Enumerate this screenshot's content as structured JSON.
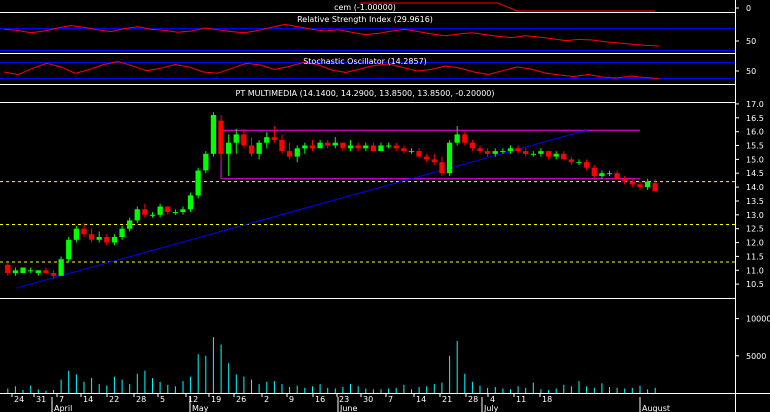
{
  "panels": {
    "cem": {
      "title": "cem (-1.00000)",
      "ticks": [
        "0"
      ]
    },
    "rsi": {
      "title": "Relative Strength Index (29.9616)",
      "ticks": [
        "50"
      ]
    },
    "stoch": {
      "title": "Stochastic Oscillator (14.2857)",
      "ticks": [
        "50"
      ]
    },
    "price": {
      "title": "PT MULTIMEDIA (14.1400, 14.2900, 13.8500, 13.8500, -0.20000)",
      "ticks": [
        "17.0",
        "16.5",
        "16.0",
        "15.5",
        "15.0",
        "14.5",
        "14.0",
        "13.5",
        "13.0",
        "12.5",
        "12.0",
        "11.5",
        "11.0",
        "10.5"
      ]
    },
    "volume": {
      "ticks": [
        "10000",
        "5000"
      ]
    }
  },
  "x_axis": {
    "day_labels": [
      "24",
      "31",
      "7",
      "14",
      "22",
      "28",
      "5",
      "12",
      "19",
      "26",
      "2",
      "9",
      "16",
      "23",
      "30",
      "7",
      "14",
      "21",
      "28",
      "4",
      "11",
      "18"
    ],
    "month_labels": [
      "April",
      "May",
      "June",
      "July",
      "August"
    ]
  },
  "colors": {
    "up_candle": "#00ff00",
    "down_candle": "#ff0000",
    "volume_bar": "#00ffff",
    "trendline": "#0000ff",
    "channel": "#ff00ff",
    "support_lines": "#ffff00",
    "indicator_line": "#ff0000",
    "band_lines": "#0000ff"
  },
  "chart_data": [
    {
      "type": "line",
      "title": "cem (-1.00000)",
      "series": [
        {
          "values": [
            0,
            0,
            0,
            0,
            0,
            0,
            0,
            0,
            -1,
            -1,
            -1,
            -1,
            -1,
            -1,
            -1,
            -1
          ]
        }
      ]
    },
    {
      "type": "line",
      "title": "Relative Strength Index (29.9616)",
      "ylim": [
        20,
        80
      ],
      "series": [
        {
          "values": [
            58,
            56,
            52,
            55,
            60,
            64,
            61,
            57,
            54,
            59,
            62,
            58,
            56,
            53,
            55,
            60,
            57,
            54,
            52,
            56,
            61,
            66,
            62,
            58,
            55,
            57,
            53,
            49,
            51,
            55,
            58,
            54,
            50,
            47,
            50,
            52,
            49,
            46,
            44,
            47,
            45,
            42,
            39,
            41,
            40,
            37,
            35,
            33,
            31,
            30
          ]
        }
      ]
    },
    {
      "type": "line",
      "title": "Stochastic Oscillator (14.2857)",
      "ylim": [
        0,
        100
      ],
      "series": [
        {
          "values": [
            40,
            30,
            55,
            75,
            60,
            35,
            50,
            70,
            82,
            65,
            45,
            55,
            70,
            60,
            40,
            35,
            55,
            75,
            68,
            50,
            62,
            78,
            70,
            48,
            38,
            52,
            66,
            72,
            58,
            44,
            50,
            64,
            56,
            40,
            30,
            45,
            60,
            52,
            36,
            28,
            22,
            30,
            20,
            16,
            24,
            18,
            14
          ]
        }
      ]
    },
    {
      "type": "candlestick",
      "title": "PT MULTIMEDIA (14.1400, 14.2900, 13.8500, 13.8500, -0.20000)",
      "ylim": [
        10.0,
        17.25
      ],
      "ohlc": [
        [
          11.2,
          11.3,
          10.8,
          10.9
        ],
        [
          10.9,
          11.1,
          10.8,
          11.0
        ],
        [
          10.9,
          11.1,
          10.9,
          11.1
        ],
        [
          11.0,
          11.1,
          10.9,
          11.0
        ],
        [
          10.9,
          11.0,
          10.8,
          11.0
        ],
        [
          11.0,
          11.1,
          10.9,
          10.9
        ],
        [
          10.9,
          11.0,
          10.7,
          10.8
        ],
        [
          10.8,
          11.5,
          10.8,
          11.4
        ],
        [
          11.4,
          12.2,
          11.3,
          12.1
        ],
        [
          12.1,
          12.6,
          12.0,
          12.5
        ],
        [
          12.5,
          12.7,
          12.2,
          12.3
        ],
        [
          12.3,
          12.5,
          12.0,
          12.1
        ],
        [
          12.1,
          12.4,
          12.0,
          12.2
        ],
        [
          12.2,
          12.3,
          11.9,
          12.0
        ],
        [
          12.0,
          12.3,
          11.9,
          12.2
        ],
        [
          12.2,
          12.6,
          12.1,
          12.5
        ],
        [
          12.5,
          12.9,
          12.4,
          12.8
        ],
        [
          12.8,
          13.3,
          12.7,
          13.2
        ],
        [
          13.2,
          13.4,
          12.9,
          13.0
        ],
        [
          13.0,
          13.1,
          12.9,
          13.0
        ],
        [
          13.0,
          13.4,
          12.9,
          13.3
        ],
        [
          13.3,
          13.3,
          13.0,
          13.1
        ],
        [
          13.1,
          13.2,
          13.0,
          13.1
        ],
        [
          13.1,
          13.3,
          13.0,
          13.2
        ],
        [
          13.2,
          13.8,
          13.1,
          13.7
        ],
        [
          13.7,
          14.7,
          13.6,
          14.6
        ],
        [
          14.6,
          15.3,
          14.5,
          15.2
        ],
        [
          15.2,
          16.7,
          15.1,
          16.6
        ],
        [
          16.4,
          16.6,
          15.0,
          15.2
        ],
        [
          15.2,
          15.9,
          14.4,
          15.6
        ],
        [
          15.6,
          16.1,
          15.2,
          15.9
        ],
        [
          15.9,
          16.1,
          15.4,
          15.5
        ],
        [
          15.5,
          15.8,
          15.1,
          15.2
        ],
        [
          15.2,
          15.7,
          15.0,
          15.6
        ],
        [
          15.6,
          16.0,
          15.4,
          15.8
        ],
        [
          15.8,
          16.2,
          15.6,
          15.7
        ],
        [
          15.7,
          15.9,
          15.2,
          15.3
        ],
        [
          15.3,
          15.6,
          15.0,
          15.1
        ],
        [
          15.1,
          15.5,
          14.9,
          15.4
        ],
        [
          15.4,
          15.6,
          15.2,
          15.5
        ],
        [
          15.5,
          15.7,
          15.3,
          15.4
        ],
        [
          15.4,
          15.7,
          15.4,
          15.6
        ],
        [
          15.6,
          15.7,
          15.4,
          15.5
        ],
        [
          15.5,
          15.8,
          15.4,
          15.6
        ],
        [
          15.6,
          15.6,
          15.3,
          15.4
        ],
        [
          15.4,
          15.7,
          15.3,
          15.5
        ],
        [
          15.5,
          15.6,
          15.3,
          15.4
        ],
        [
          15.4,
          15.6,
          15.3,
          15.5
        ],
        [
          15.5,
          15.6,
          15.3,
          15.3
        ],
        [
          15.3,
          15.6,
          15.3,
          15.5
        ],
        [
          15.5,
          15.6,
          15.4,
          15.5
        ],
        [
          15.5,
          15.6,
          15.3,
          15.4
        ],
        [
          15.4,
          15.5,
          15.2,
          15.3
        ],
        [
          15.3,
          15.4,
          15.2,
          15.3
        ],
        [
          15.3,
          15.4,
          15.1,
          15.1
        ],
        [
          15.1,
          15.2,
          14.9,
          15.0
        ],
        [
          15.0,
          15.2,
          14.8,
          14.9
        ],
        [
          14.9,
          15.1,
          14.4,
          14.5
        ],
        [
          14.5,
          15.7,
          14.4,
          15.6
        ],
        [
          15.6,
          16.2,
          15.5,
          15.9
        ],
        [
          15.9,
          16.0,
          15.5,
          15.6
        ],
        [
          15.6,
          15.7,
          15.3,
          15.4
        ],
        [
          15.4,
          15.5,
          15.2,
          15.3
        ],
        [
          15.3,
          15.4,
          15.1,
          15.2
        ],
        [
          15.2,
          15.4,
          15.1,
          15.3
        ],
        [
          15.3,
          15.4,
          15.2,
          15.3
        ],
        [
          15.3,
          15.5,
          15.2,
          15.4
        ],
        [
          15.4,
          15.5,
          15.2,
          15.3
        ],
        [
          15.3,
          15.4,
          15.1,
          15.2
        ],
        [
          15.2,
          15.3,
          15.1,
          15.2
        ],
        [
          15.2,
          15.4,
          15.1,
          15.3
        ],
        [
          15.3,
          15.3,
          15.0,
          15.1
        ],
        [
          15.1,
          15.3,
          15.0,
          15.2
        ],
        [
          15.2,
          15.3,
          15.0,
          15.0
        ],
        [
          15.0,
          15.1,
          14.8,
          14.9
        ],
        [
          14.9,
          15.0,
          14.8,
          14.9
        ],
        [
          14.9,
          15.0,
          14.6,
          14.7
        ],
        [
          14.7,
          14.8,
          14.3,
          14.4
        ],
        [
          14.4,
          14.6,
          14.3,
          14.5
        ],
        [
          14.5,
          14.6,
          14.4,
          14.5
        ],
        [
          14.5,
          14.6,
          14.3,
          14.3
        ],
        [
          14.3,
          14.4,
          14.1,
          14.2
        ],
        [
          14.2,
          14.3,
          14.0,
          14.1
        ],
        [
          14.1,
          14.2,
          13.9,
          14.0
        ],
        [
          14.0,
          14.3,
          13.9,
          14.2
        ],
        [
          14.14,
          14.29,
          13.85,
          13.85
        ]
      ],
      "trendline": {
        "from": 10.35,
        "to": 16.05
      },
      "channel": {
        "top": 16.05,
        "bottom": 14.3
      },
      "support_levels": [
        14.2,
        12.65,
        11.3
      ]
    },
    {
      "type": "bar",
      "title": "",
      "ylim": [
        0,
        12500
      ],
      "values": [
        600,
        900,
        400,
        1000,
        500,
        300,
        400,
        1800,
        3000,
        2500,
        1500,
        2000,
        1200,
        1000,
        2200,
        1800,
        1200,
        2600,
        3000,
        2000,
        1500,
        1100,
        900,
        1600,
        2200,
        5200,
        5000,
        7500,
        6500,
        4000,
        2500,
        2200,
        1800,
        1200,
        1500,
        1600,
        1200,
        800,
        1000,
        700,
        900,
        1200,
        700,
        600,
        800,
        1200,
        900,
        600,
        500,
        500,
        600,
        700,
        1100,
        500,
        800,
        900,
        1200,
        1400,
        5000,
        7000,
        2600,
        1500,
        1000,
        700,
        800,
        600,
        500,
        900,
        700,
        1400,
        500,
        400,
        600,
        1100,
        900,
        1600,
        900,
        700,
        1300,
        800,
        700,
        600,
        700,
        1000,
        500,
        700
      ]
    }
  ]
}
